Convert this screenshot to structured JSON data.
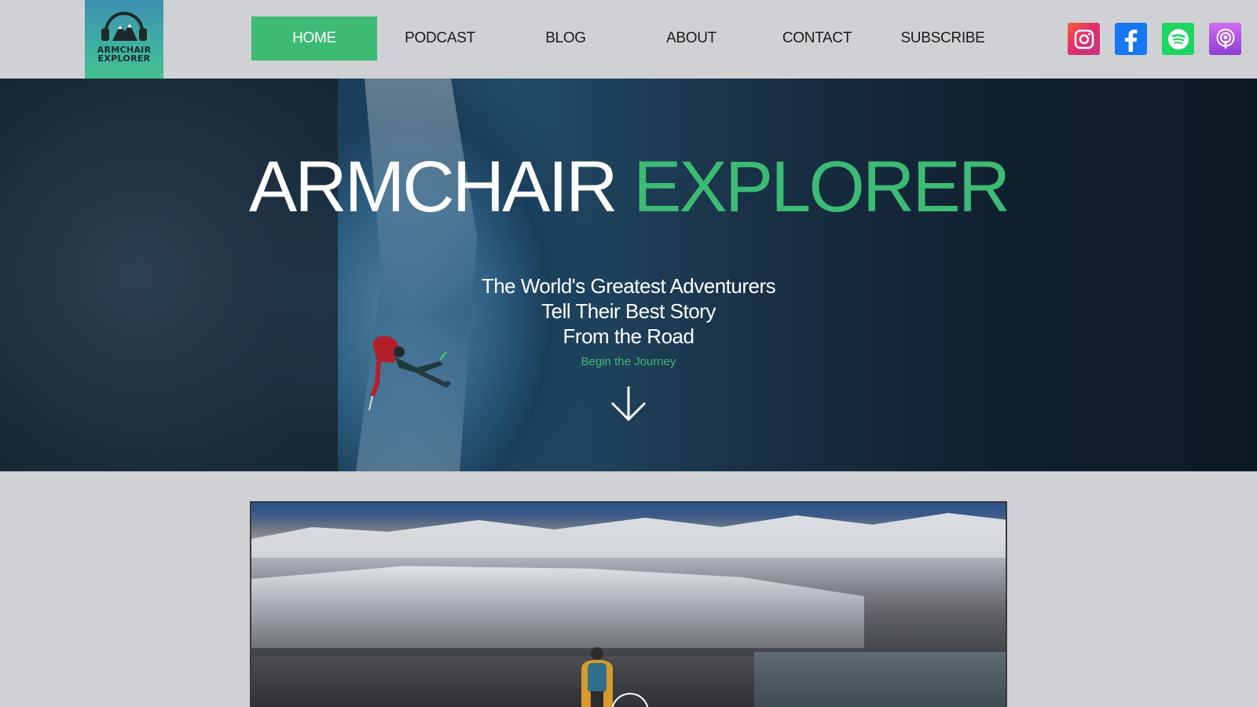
{
  "logo": {
    "line1": "ARMCHAIR",
    "line2": "EXPLORER"
  },
  "nav": {
    "items": [
      {
        "label": "HOME",
        "active": true
      },
      {
        "label": "PODCAST",
        "active": false
      },
      {
        "label": "BLOG",
        "active": false
      },
      {
        "label": "ABOUT",
        "active": false
      },
      {
        "label": "CONTACT",
        "active": false
      },
      {
        "label": "SUBSCRIBE",
        "active": false
      }
    ]
  },
  "social": {
    "icons": [
      "instagram-icon",
      "facebook-icon",
      "spotify-icon",
      "podcasts-icon"
    ]
  },
  "hero": {
    "title_white": "ARMCHAIR",
    "title_green": "EXPLORER",
    "tagline": [
      "The World's Greatest Adventurers",
      "Tell Their Best Story",
      "From the Road"
    ],
    "cta": "Begin the Journey",
    "cta_icon": "arrow-down-icon"
  },
  "colors": {
    "accent": "#3dba74",
    "background": "#cfd1d4",
    "nav_text": "#1a1a1a"
  }
}
